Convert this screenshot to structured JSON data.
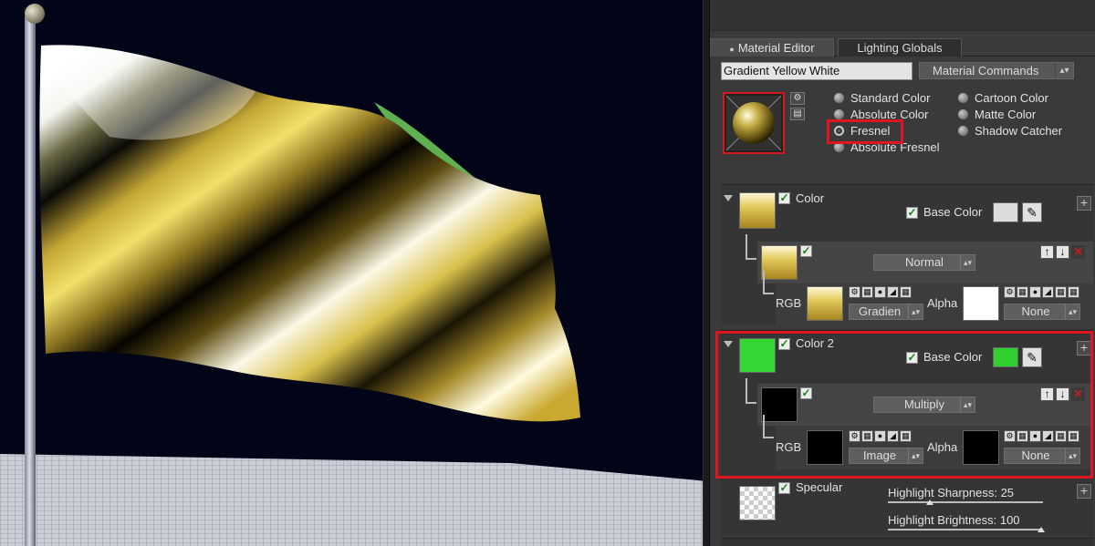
{
  "tabs": {
    "material_editor": "Material Editor",
    "lighting_globals": "Lighting Globals"
  },
  "material": {
    "name": "Gradient Yellow White",
    "commands_label": "Material Commands"
  },
  "shading_modes": [
    {
      "label": "Standard Color",
      "selected": false
    },
    {
      "label": "Absolute Color",
      "selected": false
    },
    {
      "label": "Fresnel",
      "selected": true
    },
    {
      "label": "Absolute Fresnel",
      "selected": false
    },
    {
      "label": "Cartoon Color",
      "selected": false
    },
    {
      "label": "Matte Color",
      "selected": false
    },
    {
      "label": "Shadow Catcher",
      "selected": false
    }
  ],
  "color": {
    "title": "Color",
    "base_color_label": "Base Color",
    "base_color": "#dcdcdc",
    "blend_mode": "Normal",
    "rgb_label": "RGB",
    "rgb_source": "Gradien",
    "alpha_label": "Alpha",
    "alpha_source": "None"
  },
  "color2": {
    "title": "Color 2",
    "base_color_label": "Base Color",
    "base_color": "#2fd02f",
    "blend_mode": "Multiply",
    "rgb_label": "RGB",
    "rgb_source": "Image",
    "alpha_label": "Alpha",
    "alpha_source": "None"
  },
  "specular": {
    "title": "Specular",
    "highlight_sharpness": "Highlight Sharpness: 25",
    "highlight_brightness": "Highlight Brightness: 100"
  },
  "colors": {
    "highlight_red": "#e01520",
    "panel_bg": "#3a3a3a",
    "viewport_bg": "#020417"
  },
  "icons": [
    "gear-icon",
    "settings-list-icon",
    "eyedropper-icon",
    "add-icon",
    "move-up-icon",
    "move-down-icon",
    "delete-icon"
  ]
}
